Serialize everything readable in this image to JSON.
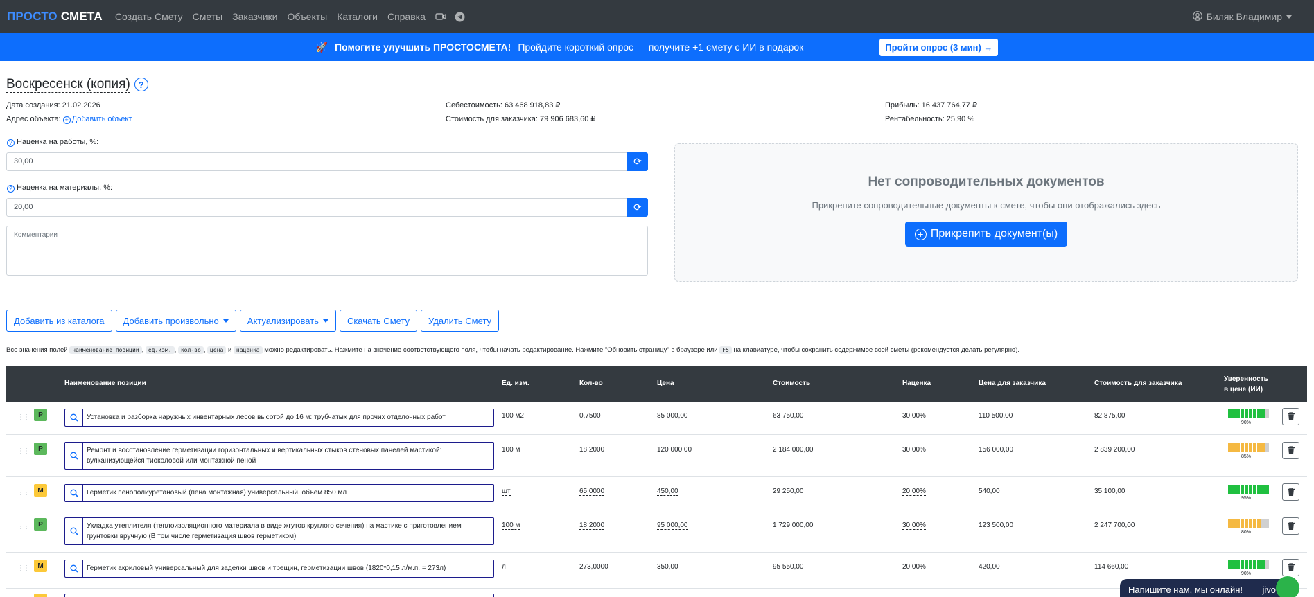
{
  "navbar": {
    "brand_part1": "ПРОСТО",
    "brand_part2": "СМЕТА",
    "links": [
      "Создать Смету",
      "Сметы",
      "Заказчики",
      "Объекты",
      "Каталоги",
      "Справка"
    ],
    "video_icon": "video-camera-icon",
    "telegram_icon": "telegram-icon",
    "user_name": "Биляк Владимир"
  },
  "promo": {
    "emoji": "🚀",
    "title": "Помогите улучшить ПРОСТОСМЕТА!",
    "text": "Пройдите короткий опрос — получите +1 смету с ИИ в подарок",
    "button": "Пройти опрос (3 мин) →"
  },
  "estimate": {
    "title": "Воскресенск (копия)",
    "help_mark": "?",
    "created": "Дата создания: 21.02.2026",
    "address_label": "Адрес объекта:",
    "add_object": "Добавить объект",
    "cost": "Себестоимость: 63 468 918,83 ₽",
    "customer_price": "Стоимость для заказчика: 79 906 683,60 ₽",
    "profit": "Прибыль: 16 437 764,77 ₽",
    "profitability": "Рентабельность: 25,90 %"
  },
  "form": {
    "work_markup_label": "Наценка на работы, %:",
    "work_markup_value": "30,00",
    "material_markup_label": "Наценка на материалы, %:",
    "material_markup_value": "20,00",
    "comment_placeholder": "Комментарии"
  },
  "docs": {
    "title": "Нет сопроводительных документов",
    "subtitle": "Прикрепите сопроводительные документы к смете, чтобы они отображались здесь",
    "button": "Прикрепить документ(ы)"
  },
  "toolbar": {
    "add_catalog": "Добавить из каталога",
    "add_custom": "Добавить произвольно",
    "actualize": "Актуализировать",
    "download": "Скачать Смету",
    "delete": "Удалить Смету"
  },
  "hint": {
    "p1": "Все значения полей",
    "c1": "наименование позиции",
    "c2": "ед.изм.",
    "c3": "кол-во",
    "c4": "цена",
    "and": "и",
    "c5": "наценка",
    "p2": "можно редактировать. Нажмите на значение соответствующего поля, чтобы начать редактирование. Нажмите \"Обновить страницу\" в браузере или",
    "c6": "F5",
    "p3": "на клавиатуре, чтобы сохранить содержимое всей сметы (рекомендуется делать регулярно)."
  },
  "table": {
    "headers": {
      "name": "Наименование позиции",
      "unit": "Ед. изм.",
      "qty": "Кол-во",
      "price": "Цена",
      "cost": "Стоимость",
      "markup": "Наценка",
      "cust_price": "Цена для заказчика",
      "cust_cost": "Стоимость для заказчика",
      "confidence_l1": "Уверенность",
      "confidence_l2": "в цене (ИИ)"
    },
    "rows": [
      {
        "type": "Р",
        "name": "Установка и разборка наружных инвентарных лесов высотой до 16 м: трубчатых для прочих отделочных работ",
        "unit": "100 м2",
        "qty": "0,7500",
        "price": "85 000,00",
        "cost": "63 750,00",
        "markup": "30,00%",
        "cust_price": "110 500,00",
        "cust_cost": "82 875,00",
        "confidence": "90%",
        "confidence_value": 90
      },
      {
        "type": "Р",
        "name": "Ремонт и восстановление герметизации горизонтальных и вертикальных стыков стеновых панелей мастикой: вулканизующейся тиоколовой или монтажной пеной",
        "unit": "100 м",
        "qty": "18,2000",
        "price": "120 000,00",
        "cost": "2 184 000,00",
        "markup": "30,00%",
        "cust_price": "156 000,00",
        "cust_cost": "2 839 200,00",
        "confidence": "85%",
        "confidence_value": 85
      },
      {
        "type": "М",
        "name": "Герметик пенополиуретановый (пена монтажная) универсальный, объем 850 мл",
        "unit": "шт",
        "qty": "65,0000",
        "price": "450,00",
        "cost": "29 250,00",
        "markup": "20,00%",
        "cust_price": "540,00",
        "cust_cost": "35 100,00",
        "confidence": "95%",
        "confidence_value": 95
      },
      {
        "type": "Р",
        "name": "Укладка утеплителя (теплоизоляционного материала в виде жгутов круглого сечения) на мастике с приготовлением грунтовки вручную (В том числе герметизация швов герметиком)",
        "unit": "100 м",
        "qty": "18,2000",
        "price": "95 000,00",
        "cost": "1 729 000,00",
        "markup": "30,00%",
        "cust_price": "123 500,00",
        "cust_cost": "2 247 700,00",
        "confidence": "80%",
        "confidence_value": 80
      },
      {
        "type": "М",
        "name": "Герметик акриловый универсальный для заделки швов и трещин, герметизации швов (1820*0,15 л/м.п. = 273л)",
        "unit": "л",
        "qty": "273,0000",
        "price": "350,00",
        "cost": "95 550,00",
        "markup": "20,00%",
        "cust_price": "420,00",
        "cust_cost": "114 660,00",
        "confidence": "90%",
        "confidence_value": 90
      }
    ]
  },
  "chat": {
    "text": "Напишите нам, мы онлайн!",
    "brand": "jivo"
  },
  "colors": {
    "navbar": "#343a40",
    "primary": "#0d6efd",
    "work_badge": "#5cb85c",
    "material_badge": "#fcc93a",
    "confidence_high": "#20c040",
    "confidence_mid": "#f5b942"
  }
}
